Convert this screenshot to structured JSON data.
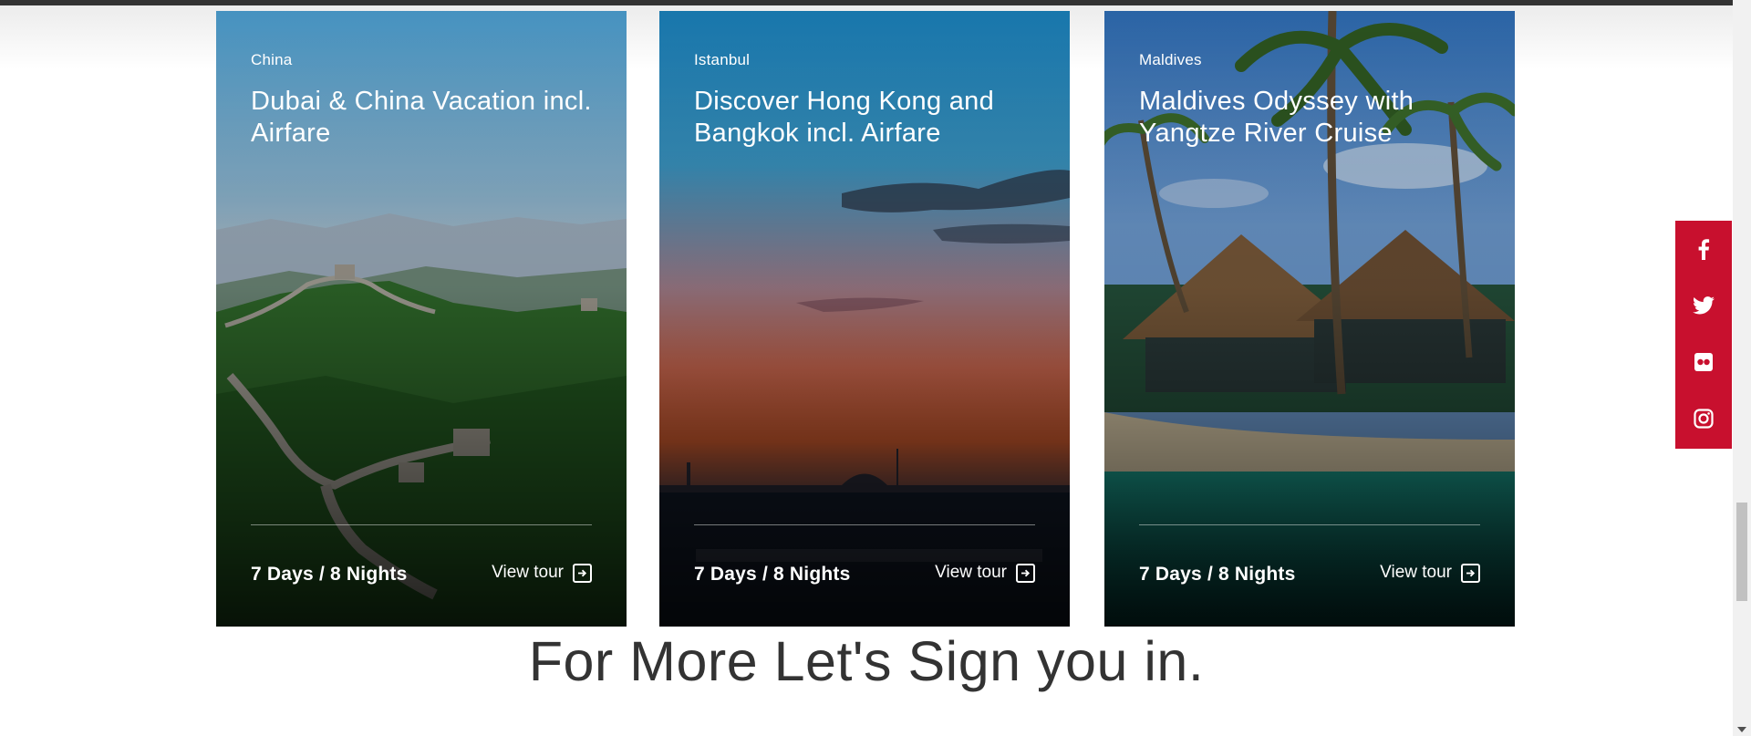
{
  "tours": [
    {
      "location": "China",
      "title": "Dubai & China Vacation incl. Airfare",
      "duration": "7 Days / 8 Nights",
      "cta": "View tour"
    },
    {
      "location": "Istanbul",
      "title": "Discover Hong Kong and Bangkok incl. Airfare",
      "duration": "7 Days / 8 Nights",
      "cta": "View tour"
    },
    {
      "location": "Maldives",
      "title": "Maldives Odyssey with Yangtze River Cruise",
      "duration": "7 Days / 8 Nights",
      "cta": "View tour"
    }
  ],
  "signin_heading": "For More Let's Sign you in.",
  "social": {
    "color": "#c8102e",
    "icons": [
      "facebook-icon",
      "twitter-icon",
      "flickr-icon",
      "instagram-icon"
    ]
  }
}
